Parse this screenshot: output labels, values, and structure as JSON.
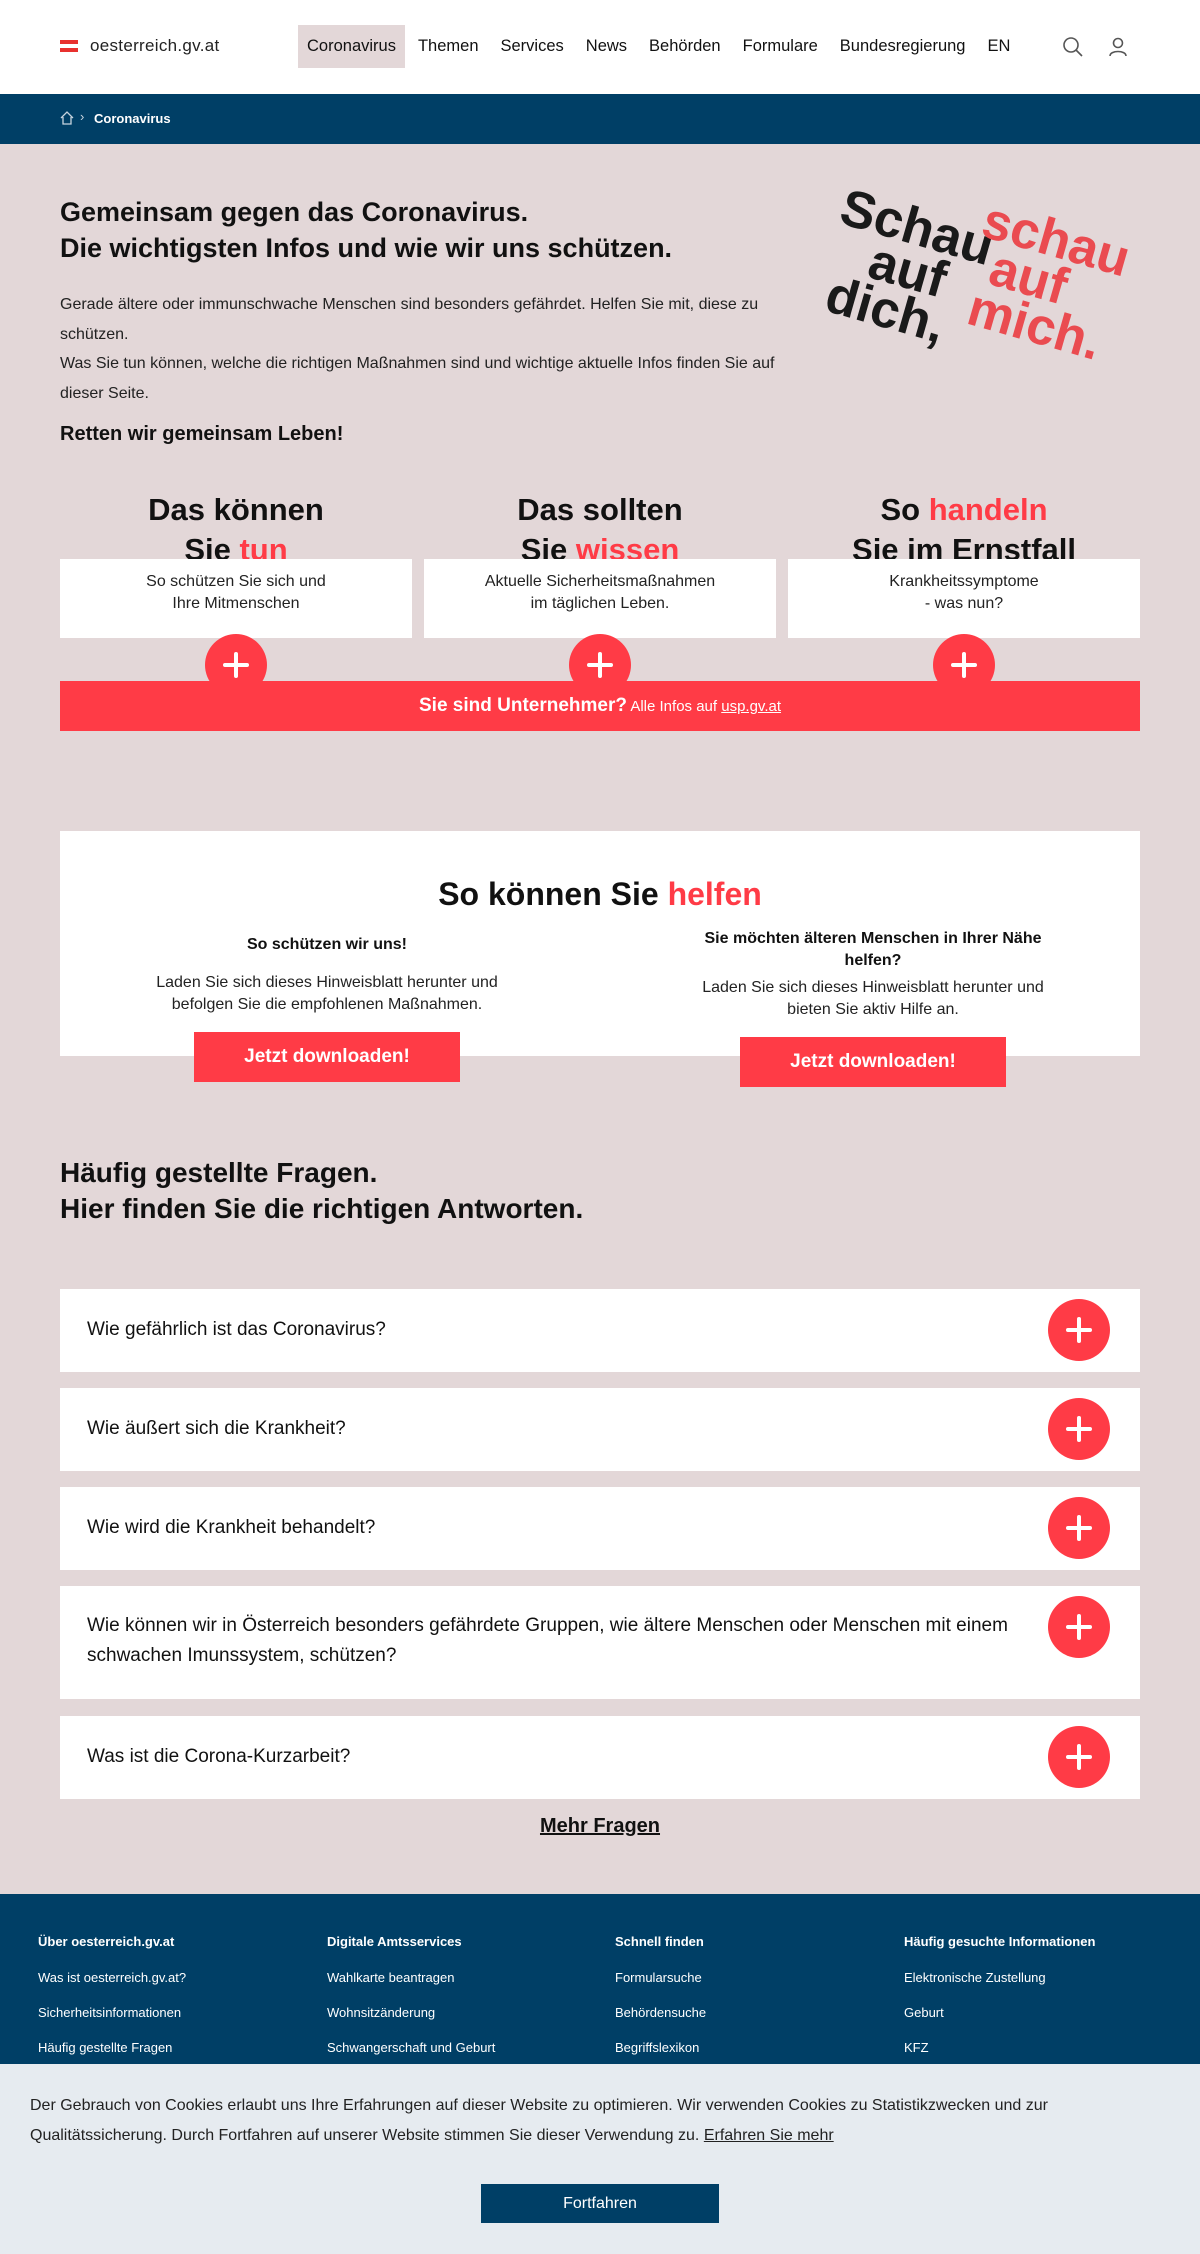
{
  "header": {
    "logo_text": "oesterreich.gv.at",
    "nav": [
      "Coronavirus",
      "Themen",
      "Services",
      "News",
      "Behörden",
      "Formulare",
      "Bundesregierung",
      "EN"
    ]
  },
  "breadcrumb": {
    "current": "Coronavirus"
  },
  "intro": {
    "title_line1": "Gemeinsam gegen das Coronavirus.",
    "title_line2": "Die wichtigsten Infos und wie wir uns schützen.",
    "p1": "Gerade ältere oder immunschwache Menschen sind besonders gefährdet. Helfen Sie mit, diese zu schützen.",
    "p2": "Was Sie tun können, welche die richtigen Maßnahmen sind und wichtige aktuelle Infos finden Sie auf dieser Seite.",
    "strong": "Retten wir gemeinsam Leben!"
  },
  "slogan": {
    "black": [
      "Schau",
      "auf",
      "dich,"
    ],
    "red": [
      "schau",
      "auf",
      "mich."
    ]
  },
  "cards": [
    {
      "l1": "Das können",
      "l2_pre": "Sie ",
      "l2_accent": "tun",
      "accent_first": false,
      "text1": "So schützen Sie sich und",
      "text2": "Ihre Mitmenschen"
    },
    {
      "l1": "Das sollten",
      "l2_pre": "Sie ",
      "l2_accent": "wissen",
      "accent_first": false,
      "text1": "Aktuelle Sicherheitsmaßnahmen",
      "text2": "im täglichen Leben."
    },
    {
      "l1_pre": "So ",
      "l1_accent": "handeln",
      "l2": "Sie im Ernstfall",
      "text1": "Krankheitssymptome",
      "text2": "- was nun?"
    }
  ],
  "business": {
    "strong": "Sie sind Unternehmer?",
    "small": " Alle Infos auf ",
    "link": "usp.gv.at"
  },
  "help": {
    "title_pre": "So können Sie ",
    "title_accent": "helfen",
    "left_title": "So schützen wir uns!",
    "left_text1": "Laden Sie sich dieses Hinweisblatt herunter und",
    "left_text2": "befolgen Sie die empfohlenen Maßnahmen.",
    "right_title1": "Sie möchten älteren Menschen in Ihrer Nähe",
    "right_title2": "helfen?",
    "right_text1": "Laden Sie sich dieses Hinweisblatt herunter und",
    "right_text2": "bieten Sie aktiv Hilfe an.",
    "button": "Jetzt downloaden!"
  },
  "faq": {
    "title_line1": "Häufig gestellte Fragen.",
    "title_line2": "Hier finden Sie die richtigen Antworten.",
    "items": [
      "Wie gefährlich ist das Coronavirus?",
      "Wie äußert sich die Krankheit?",
      "Wie wird die Krankheit behandelt?",
      "Wie können wir in Österreich besonders gefährdete Gruppen, wie ältere Menschen oder Menschen mit einem schwachen Imunssystem, schützen?",
      "Was ist die Corona-Kurzarbeit?"
    ],
    "more": "Mehr Fragen"
  },
  "footer": {
    "columns": [
      {
        "head": "Über oesterreich.gv.at",
        "links": [
          "Was ist oesterreich.gv.at?",
          "Sicherheitsinformationen",
          "Häufig gestellte Fragen"
        ]
      },
      {
        "head": "Digitale Amtsservices",
        "links": [
          "Wahlkarte beantragen",
          "Wohnsitzänderung",
          "Schwangerschaft und Geburt"
        ]
      },
      {
        "head": "Schnell finden",
        "links": [
          "Formularsuche",
          "Behördensuche",
          "Begriffslexikon"
        ]
      },
      {
        "head": "Häufig gesuchte Informationen",
        "links": [
          "Elektronische Zustellung",
          "Geburt",
          "KFZ"
        ]
      }
    ]
  },
  "cookie": {
    "text": "Der Gebrauch von Cookies erlaubt uns Ihre Erfahrungen auf dieser Website zu optimieren. Wir verwenden Cookies zu Statistikzwecken und zur Qualitätssicherung. Durch Fortfahren auf unserer Website stimmen Sie dieser Verwendung zu.",
    "link": "Erfahren Sie mehr",
    "button": "Fortfahren"
  },
  "colors": {
    "accent": "#ff3b46",
    "navy": "#003f66",
    "background": "#e3d7d8",
    "flag_red": "#e8312f"
  }
}
